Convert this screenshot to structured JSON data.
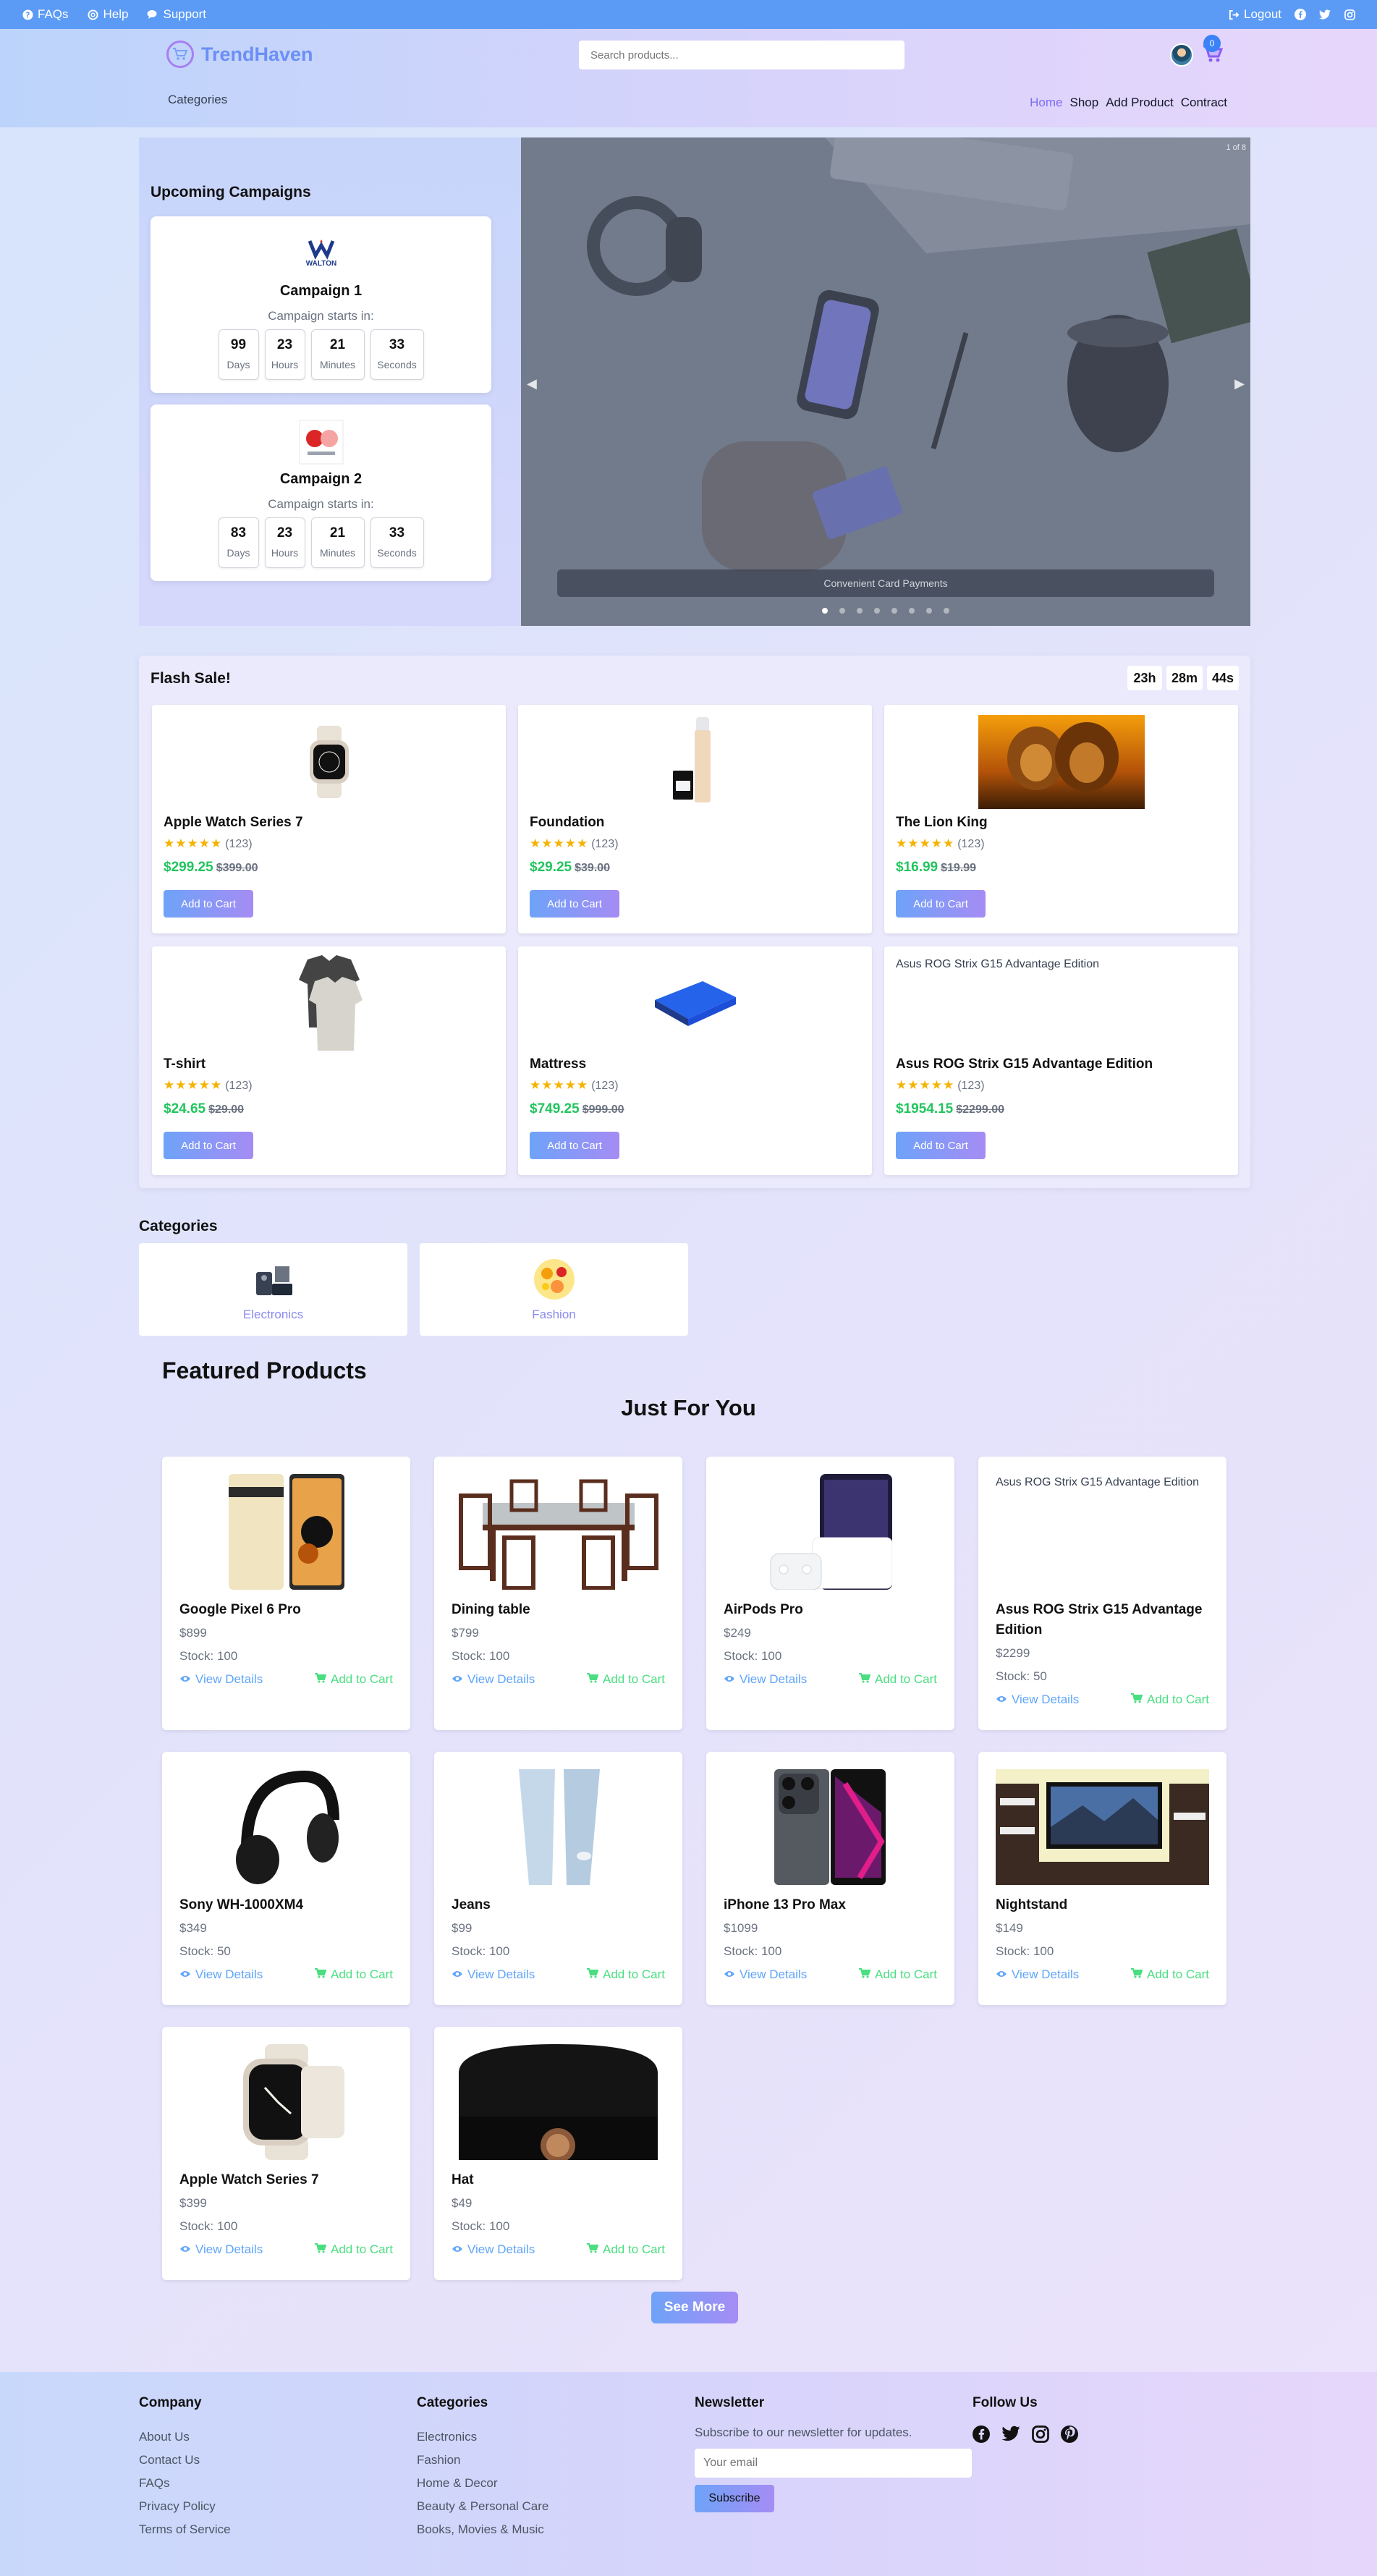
{
  "topbar": {
    "faqs": "FAQs",
    "help": "Help",
    "support": "Support",
    "logout": "Logout"
  },
  "header": {
    "brand": "TrendHaven",
    "search_placeholder": "Search products...",
    "cart_count": "0",
    "categories_label": "Categories",
    "nav": [
      "Home",
      "Shop",
      "Add Product",
      "Contract"
    ]
  },
  "campaigns": {
    "title": "Upcoming Campaigns",
    "items": [
      {
        "name": "Campaign 1",
        "sub": "Campaign starts in:",
        "logo": "walton-logo",
        "days": "99",
        "hours": "23",
        "minutes": "21",
        "seconds": "33"
      },
      {
        "name": "Campaign 2",
        "sub": "Campaign starts in:",
        "logo": "campaign-2-logo",
        "days": "83",
        "hours": "23",
        "minutes": "21",
        "seconds": "33"
      }
    ],
    "labels": {
      "days": "Days",
      "hours": "Hours",
      "minutes": "Minutes",
      "seconds": "Seconds"
    },
    "walton_text": "WALTON"
  },
  "carousel": {
    "counter": "1 of 8",
    "caption": "Convenient Card Payments",
    "slides": 8,
    "active": 0
  },
  "flash": {
    "title": "Flash Sale!",
    "timer": [
      "23h",
      "28m",
      "44s"
    ],
    "add_label": "Add to Cart",
    "products": [
      {
        "name": "Apple Watch Series 7",
        "rating": "(123)",
        "price": "$299.25",
        "old": "$399.00",
        "img": "watch-image"
      },
      {
        "name": "Foundation",
        "rating": "(123)",
        "price": "$29.25",
        "old": "$39.00",
        "img": "foundation-image"
      },
      {
        "name": "The Lion King",
        "rating": "(123)",
        "price": "$16.99",
        "old": "$19.99",
        "img": "lion-king-image"
      },
      {
        "name": "T-shirt",
        "rating": "(123)",
        "price": "$24.65",
        "old": "$29.00",
        "img": "tshirt-image"
      },
      {
        "name": "Mattress",
        "rating": "(123)",
        "price": "$749.25",
        "old": "$999.00",
        "img": "mattress-image"
      },
      {
        "name": "Asus ROG Strix G15 Advantage Edition",
        "rating": "(123)",
        "price": "$1954.15",
        "old": "$2299.00",
        "img": "broken-image",
        "alt": "Asus ROG Strix G15 Advantage Edition"
      }
    ],
    "stars": "★★★★★"
  },
  "categories": {
    "title": "Categories",
    "items": [
      {
        "name": "Electronics",
        "icon": "electronics-icon"
      },
      {
        "name": "Fashion",
        "icon": "fashion-icon"
      }
    ]
  },
  "featured": {
    "title": "Featured Products",
    "subtitle": "Just For You",
    "view_label": "View Details",
    "add_label": "Add to Cart",
    "products": [
      {
        "name": "Google Pixel 6 Pro",
        "price": "$899",
        "stock": "Stock: 100",
        "img": "pixel-image"
      },
      {
        "name": "Dining table",
        "price": "$799",
        "stock": "Stock: 100",
        "img": "dining-image"
      },
      {
        "name": "AirPods Pro",
        "price": "$249",
        "stock": "Stock: 100",
        "img": "airpods-image"
      },
      {
        "name": "Asus ROG Strix G15 Advantage Edition",
        "price": "$2299",
        "stock": "Stock: 50",
        "img": "broken-image",
        "alt": "Asus ROG Strix G15 Advantage Edition"
      },
      {
        "name": "Sony WH-1000XM4",
        "price": "$349",
        "stock": "Stock: 50",
        "img": "headphones-image"
      },
      {
        "name": "Jeans",
        "price": "$99",
        "stock": "Stock: 100",
        "img": "jeans-image"
      },
      {
        "name": "iPhone 13 Pro Max",
        "price": "$1099",
        "stock": "Stock: 100",
        "img": "iphone-image"
      },
      {
        "name": "Nightstand",
        "price": "$149",
        "stock": "Stock: 100",
        "img": "nightstand-image"
      },
      {
        "name": "Apple Watch Series 7",
        "price": "$399",
        "stock": "Stock: 100",
        "img": "watch-image"
      },
      {
        "name": "Hat",
        "price": "$49",
        "stock": "Stock: 100",
        "img": "hat-image"
      }
    ],
    "see_more": "See More"
  },
  "footer": {
    "company": {
      "title": "Company",
      "links": [
        "About Us",
        "Contact Us",
        "FAQs",
        "Privacy Policy",
        "Terms of Service"
      ]
    },
    "categories": {
      "title": "Categories",
      "links": [
        "Electronics",
        "Fashion",
        "Home & Decor",
        "Beauty & Personal Care",
        "Books, Movies & Music"
      ]
    },
    "newsletter": {
      "title": "Newsletter",
      "text": "Subscribe to our newsletter for updates.",
      "placeholder": "Your email",
      "button": "Subscribe"
    },
    "follow": {
      "title": "Follow Us",
      "icons": [
        "facebook-icon",
        "twitter-icon",
        "instagram-icon",
        "pinterest-icon"
      ]
    }
  }
}
